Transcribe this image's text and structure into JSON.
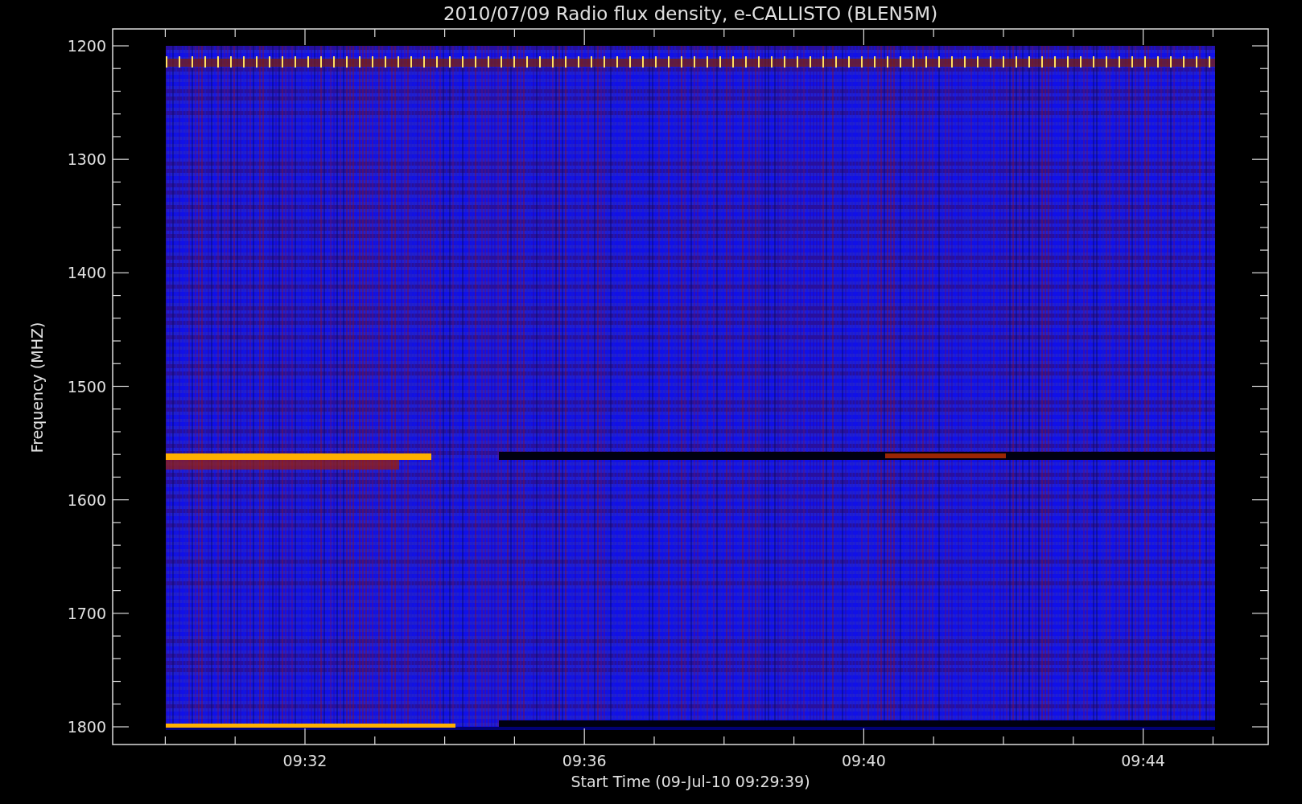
{
  "plot": {
    "title": "2010/07/09  Radio flux density, e-CALLISTO (BLEN5M)",
    "xlabel": "Start Time (09-Jul-10 09:29:39)",
    "ylabel": "Frequency (MHZ)",
    "xticks": [
      "09:32",
      "09:36",
      "09:40",
      "09:44"
    ],
    "yticks": [
      "1200",
      "1300",
      "1400",
      "1500",
      "1600",
      "1700",
      "1800"
    ]
  }
}
